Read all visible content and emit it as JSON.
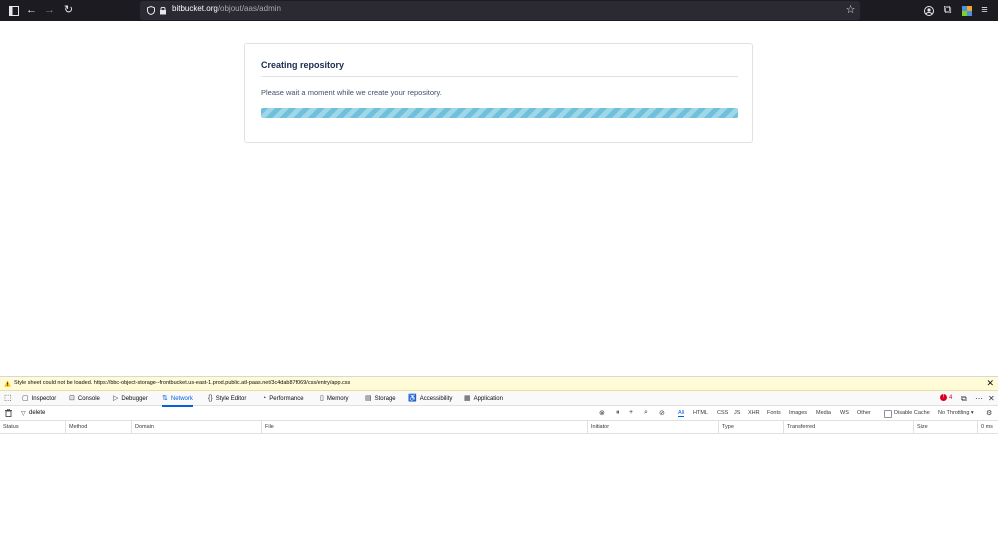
{
  "browser": {
    "url_domain": "bitbucket.org",
    "url_path": "/objout/aas/admin"
  },
  "page": {
    "card_title": "Creating repository",
    "message": "Please wait a moment while we create your repository.",
    "progress_fraction": 1.0
  },
  "devtools": {
    "notice": "Style sheet could not be loaded. https://bbc-object-storage--frontbucket.us-east-1.prod.public.atl-paas.net/3c4dab87f069/css/entry/app.css",
    "tabs": [
      "Inspector",
      "Console",
      "Debugger",
      "Network",
      "Style Editor",
      "Performance",
      "Memory",
      "Storage",
      "Accessibility",
      "Application"
    ],
    "active_tab": "Network",
    "error_count": "4",
    "filter_value": "delete",
    "type_filters": [
      "All",
      "HTML",
      "CSS",
      "JS",
      "XHR",
      "Fonts",
      "Images",
      "Media",
      "WS",
      "Other"
    ],
    "disable_cache_label": "Disable Cache",
    "throttling_label": "No Throttling",
    "columns": [
      "Status",
      "Method",
      "Domain",
      "File",
      "Initiator",
      "Type",
      "Transferred",
      "Size"
    ],
    "timing_label": "0 ms"
  },
  "colors": {
    "progress_stripe_a": "#6fc0da",
    "progress_stripe_b": "#9fd6e8",
    "accent": "#0060df",
    "error": "#d70022"
  }
}
